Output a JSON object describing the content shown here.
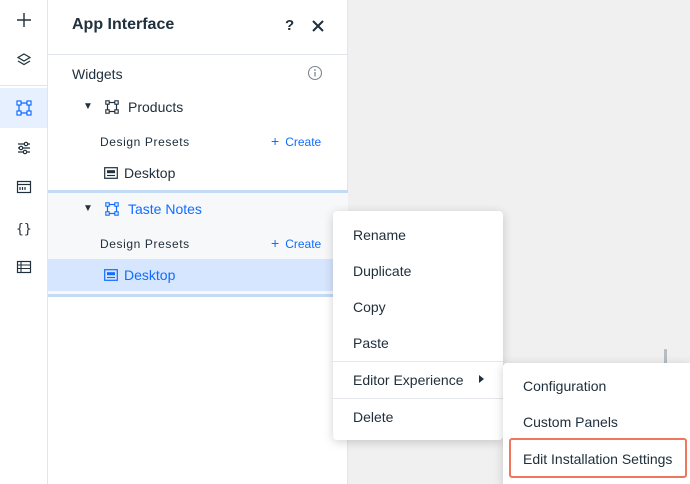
{
  "panel": {
    "title": "App Interface",
    "help_label": "?",
    "section_label": "Widgets",
    "widgets": [
      {
        "name": "Products",
        "presets_label": "Design Presets",
        "create_label": "Create",
        "presets": [
          {
            "name": "Desktop"
          }
        ]
      },
      {
        "name": "Taste Notes",
        "presets_label": "Design Presets",
        "create_label": "Create",
        "presets": [
          {
            "name": "Desktop"
          }
        ]
      }
    ]
  },
  "rail": {
    "icons": [
      "plus-icon",
      "layers-icon",
      "widget-frame-icon",
      "sliders-icon",
      "code-panel-icon",
      "braces-icon",
      "table-icon"
    ]
  },
  "context_menu": {
    "items": [
      "Rename",
      "Duplicate",
      "Copy",
      "Paste",
      "Editor Experience",
      "Delete"
    ]
  },
  "submenu": {
    "items": [
      "Configuration",
      "Custom Panels",
      "Edit Installation Settings"
    ]
  },
  "colors": {
    "accent": "#116dff",
    "selected_row": "#d6e6fe",
    "highlight": "#f0765d"
  }
}
